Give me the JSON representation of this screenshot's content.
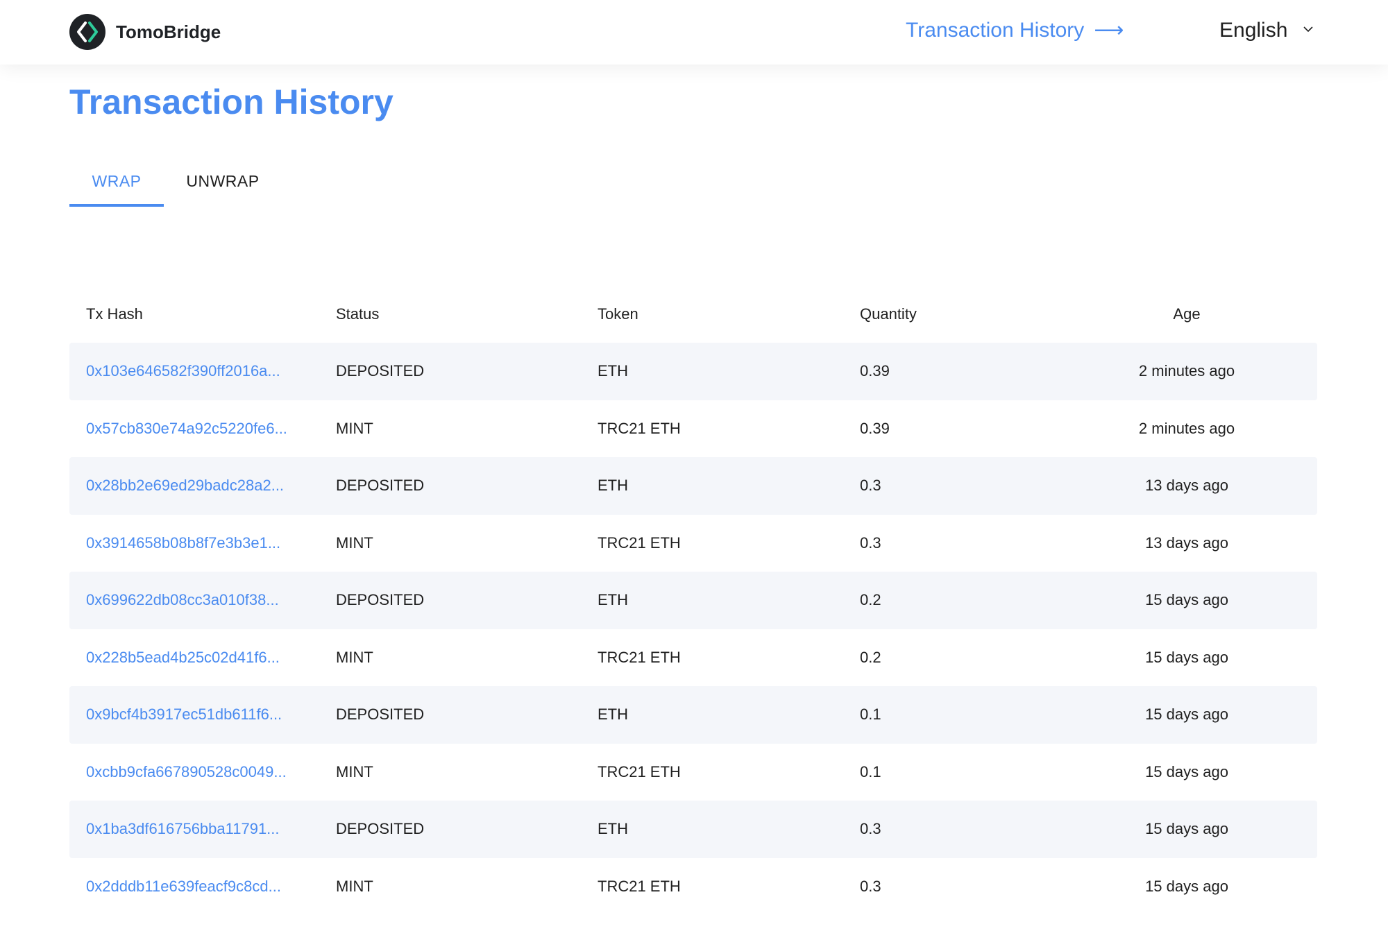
{
  "header": {
    "brand_name": "TomoBridge",
    "history_link": "Transaction History",
    "history_arrow": "⟶",
    "language": "English"
  },
  "page": {
    "title": "Transaction History"
  },
  "tabs": [
    {
      "label": "WRAP",
      "active": true
    },
    {
      "label": "UNWRAP",
      "active": false
    }
  ],
  "table": {
    "columns": [
      "Tx Hash",
      "Status",
      "Token",
      "Quantity",
      "Age"
    ],
    "rows": [
      {
        "hash": "0x103e646582f390ff2016a...",
        "status": "DEPOSITED",
        "token": "ETH",
        "quantity": "0.39",
        "age": "2 minutes ago"
      },
      {
        "hash": "0x57cb830e74a92c5220fe6...",
        "status": "MINT",
        "token": "TRC21 ETH",
        "quantity": "0.39",
        "age": "2 minutes ago"
      },
      {
        "hash": "0x28bb2e69ed29badc28a2...",
        "status": "DEPOSITED",
        "token": "ETH",
        "quantity": "0.3",
        "age": "13 days ago"
      },
      {
        "hash": "0x3914658b08b8f7e3b3e1...",
        "status": "MINT",
        "token": "TRC21 ETH",
        "quantity": "0.3",
        "age": "13 days ago"
      },
      {
        "hash": "0x699622db08cc3a010f38...",
        "status": "DEPOSITED",
        "token": "ETH",
        "quantity": "0.2",
        "age": "15 days ago"
      },
      {
        "hash": "0x228b5ead4b25c02d41f6...",
        "status": "MINT",
        "token": "TRC21 ETH",
        "quantity": "0.2",
        "age": "15 days ago"
      },
      {
        "hash": "0x9bcf4b3917ec51db611f6...",
        "status": "DEPOSITED",
        "token": "ETH",
        "quantity": "0.1",
        "age": "15 days ago"
      },
      {
        "hash": "0xcbb9cfa667890528c0049...",
        "status": "MINT",
        "token": "TRC21 ETH",
        "quantity": "0.1",
        "age": "15 days ago"
      },
      {
        "hash": "0x1ba3df616756bba11791...",
        "status": "DEPOSITED",
        "token": "ETH",
        "quantity": "0.3",
        "age": "15 days ago"
      },
      {
        "hash": "0x2dddb11e639feacf9c8cd...",
        "status": "MINT",
        "token": "TRC21 ETH",
        "quantity": "0.3",
        "age": "15 days ago"
      }
    ]
  },
  "colors": {
    "accent": "#4a8bf0",
    "row_shade": "#f4f6fa",
    "logo_bg": "#1f2226",
    "logo_green": "#2ecc9a"
  },
  "icons": {
    "logo": "tomobridge-logo-icon",
    "arrow": "arrow-right-icon",
    "caret": "chevron-down-icon"
  }
}
